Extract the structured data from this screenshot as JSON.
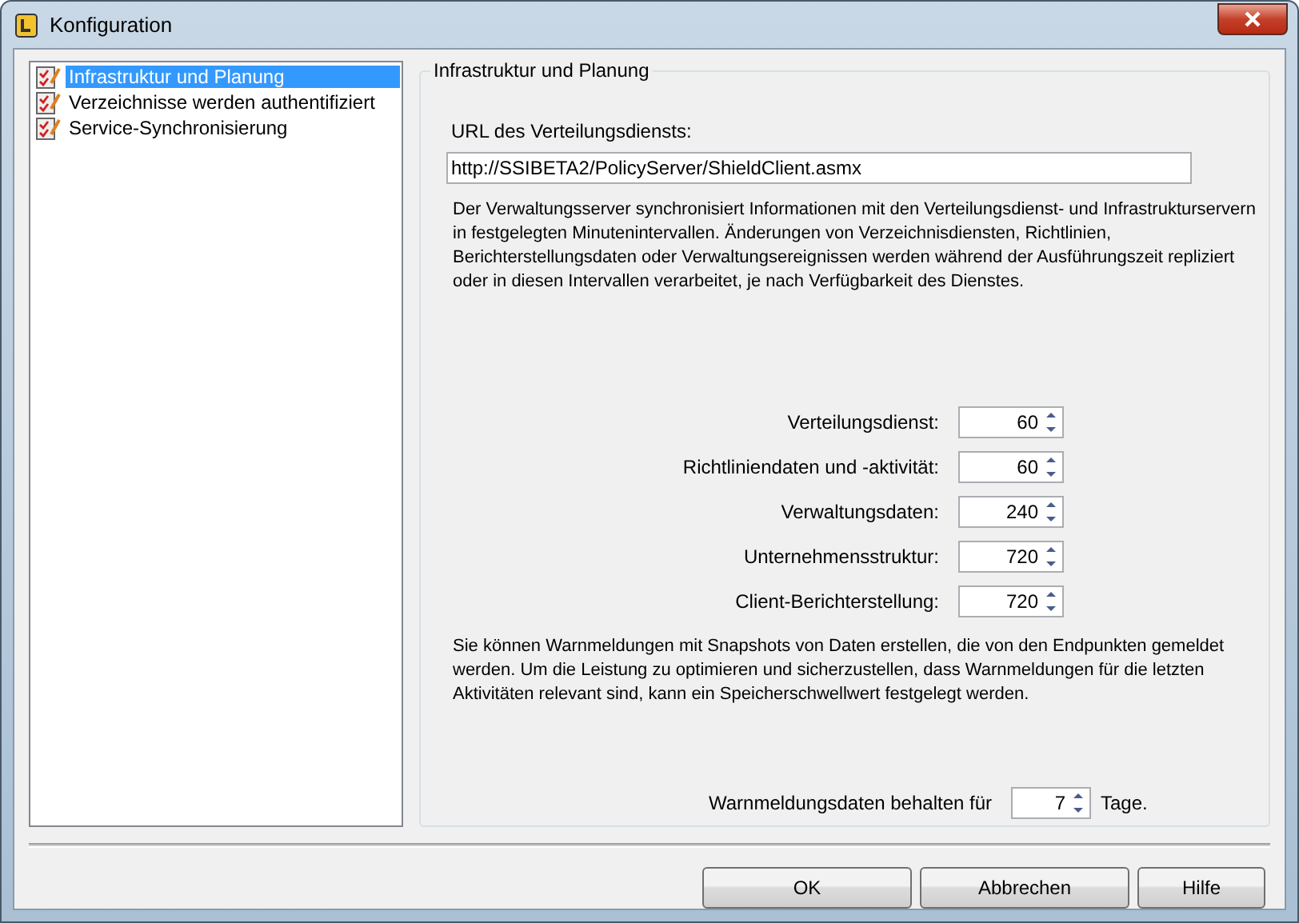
{
  "window": {
    "title": "Konfiguration"
  },
  "sidebar": {
    "items": [
      {
        "label": "Infrastruktur und Planung",
        "selected": true
      },
      {
        "label": "Verzeichnisse werden authentifiziert",
        "selected": false
      },
      {
        "label": "Service-Synchronisierung",
        "selected": false
      }
    ]
  },
  "group": {
    "title": "Infrastruktur und Planung",
    "url_label": "URL des Verteilungsdiensts:",
    "url_value": "http://SSIBETA2/PolicyServer/ShieldClient.asmx",
    "description": "Der Verwaltungsserver synchronisiert Informationen mit den Verteilungsdienst- und Infrastrukturservern in festgelegten Minutenintervallen. Änderungen von Verzeichnisdiensten, Richtlinien, Berichterstellungsdaten oder Verwaltungsereignissen werden während der Ausführungszeit repliziert oder in diesen Intervallen verarbeitet, je nach Verfügbarkeit des Dienstes.",
    "intervals": [
      {
        "label": "Verteilungsdienst:",
        "value": "60"
      },
      {
        "label": "Richtliniendaten und -aktivität:",
        "value": "60"
      },
      {
        "label": "Verwaltungsdaten:",
        "value": "240"
      },
      {
        "label": "Unternehmensstruktur:",
        "value": "720"
      },
      {
        "label": "Client-Berichterstellung:",
        "value": "720"
      }
    ],
    "alerts_description": "Sie können Warnmeldungen mit Snapshots von Daten erstellen, die von den Endpunkten gemeldet werden. Um die Leistung zu optimieren und sicherzustellen, dass Warnmeldungen für die letzten Aktivitäten relevant sind, kann ein Speicherschwellwert festgelegt werden.",
    "retention": {
      "label": "Warnmeldungsdaten behalten für",
      "value": "7",
      "unit": "Tage."
    }
  },
  "buttons": [
    "OK",
    "Abbrechen",
    "Hilfe"
  ]
}
